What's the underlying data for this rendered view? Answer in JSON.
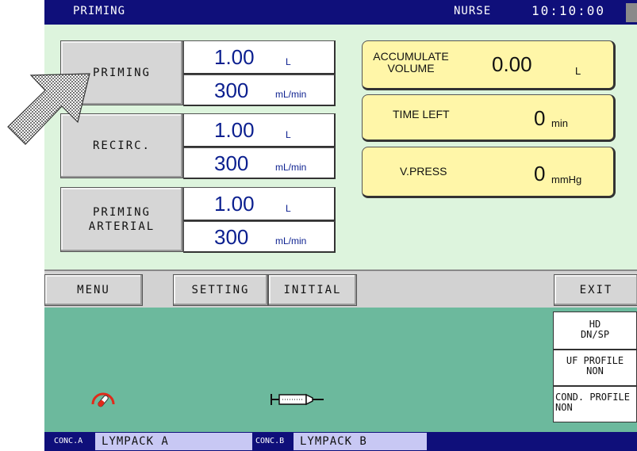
{
  "header": {
    "screen_title": "PRIMING",
    "user": "NURSE",
    "time": "10:10:00"
  },
  "left_controls": [
    {
      "label": "PRIMING",
      "volume": "1.00",
      "volume_unit": "L",
      "rate": "300",
      "rate_unit": "mL/min"
    },
    {
      "label": "RECIRC.",
      "volume": "1.00",
      "volume_unit": "L",
      "rate": "300",
      "rate_unit": "mL/min"
    },
    {
      "label": "PRIMING\nARTERIAL",
      "volume": "1.00",
      "volume_unit": "L",
      "rate": "300",
      "rate_unit": "mL/min"
    }
  ],
  "readouts": [
    {
      "label": "ACCUMULATE\nVOLUME",
      "value": "0.00",
      "unit": "L"
    },
    {
      "label": "TIME LEFT",
      "value": "0",
      "unit": "min"
    },
    {
      "label": "V.PRESS",
      "value": "0",
      "unit": "mmHg"
    }
  ],
  "menu": {
    "menu": "MENU",
    "setting": "SETTING",
    "initial": "INITIAL",
    "exit": "EXIT"
  },
  "side_status": [
    {
      "text": "HD\nDN/SP"
    },
    {
      "text": "UF PROFILE\nNON"
    },
    {
      "text": "COND. PROFILE\nNON"
    }
  ],
  "footer": {
    "conc_a_label": "CONC.A",
    "conc_a_value": "LYMPACK A",
    "conc_b_label": "CONC.B",
    "conc_b_value": "LYMPACK B"
  },
  "colors": {
    "title_bar": "#0f0f7a",
    "main_panel": "#ddf4dd",
    "readout_box": "#fff6a8",
    "bottom_panel": "#6cb99d",
    "value_text": "#0b1f8f"
  },
  "icons": {
    "pointer": "pointer-arrow-icon",
    "pressure_gauge": "gauge-icon",
    "syringe": "syringe-icon"
  }
}
